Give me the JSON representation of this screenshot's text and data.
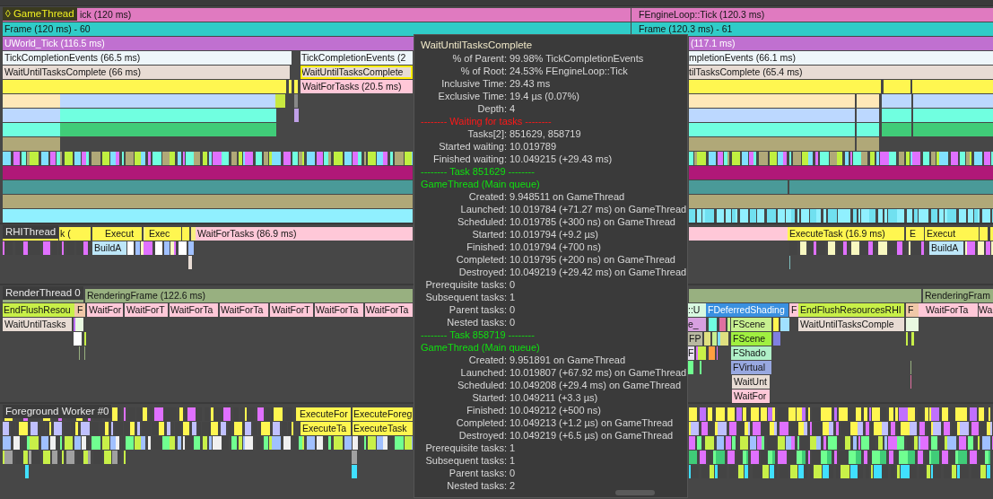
{
  "tracks": [
    {
      "name": "GameThread",
      "marker": "◊",
      "selected": true,
      "rows": [
        {
          "events": [
            {
              "text": "ick (120 ms)",
              "color": "#e07ac0",
              "selected": false
            },
            {
              "text": "FEngineLoop::Tick (120.3 ms)",
              "color": "#e07ac0",
              "selected": false
            }
          ]
        },
        {
          "events": [
            {
              "text": "Frame (120 ms) -  60",
              "color": "#30ccc8",
              "selected": false
            },
            {
              "text": "Frame (120.3 ms) -  61",
              "color": "#30ccc8",
              "selected": false
            }
          ]
        },
        {
          "events": [
            {
              "text": "UWorld_Tick (116.5 ms)",
              "color": "#c070d0",
              "selected": false
            },
            {
              "text": "(117.1 ms)",
              "color": "#c070d0",
              "selected": false
            }
          ]
        },
        {
          "events": [
            {
              "text": "TickCompletionEvents (66.5 ms)",
              "color": "#eef6fa",
              "selected": false
            },
            {
              "text": "TickCompletionEvents (2",
              "color": "#eef6fa",
              "selected": false
            },
            {
              "text": "mpletionEvents (66.1 ms)",
              "color": "#eef6fa",
              "selected": false
            }
          ]
        },
        {
          "events": [
            {
              "text": "WaitUntilTasksComplete (66 ms)",
              "color": "#e8dcd4",
              "selected": false
            },
            {
              "text": "WaitUntilTasksComplete",
              "color": "#e8dcd4",
              "selected": true
            },
            {
              "text": "tilTasksComplete (65.4 ms)",
              "color": "#e8dcd4",
              "selected": false
            }
          ]
        },
        {
          "events": [
            {
              "text": "WaitForTasks (20.5 ms)",
              "color": "#ffc8d8",
              "selected": false
            }
          ]
        }
      ]
    },
    {
      "name": "RHIThread",
      "selected": false,
      "rows": [
        {
          "events": [
            {
              "text": "k (",
              "color": "#fff650",
              "selected": false
            },
            {
              "text": "Execut",
              "color": "#fff650",
              "selected": false
            },
            {
              "text": "Exec",
              "color": "#fff650",
              "selected": false
            },
            {
              "text": "WaitForTasks (86.9 ms)",
              "color": "#ffc8d8",
              "selected": false
            },
            {
              "text": "ExecuteTask (16.9 ms)",
              "color": "#fff650",
              "selected": false
            },
            {
              "text": "E",
              "color": "#fff650",
              "selected": false
            },
            {
              "text": "Execut",
              "color": "#fff650",
              "selected": false
            }
          ]
        },
        {
          "events": [
            {
              "text": "BuildA",
              "color": "#bde6f8",
              "selected": false
            },
            {
              "text": "BuildA",
              "color": "#bde6f8",
              "selected": false
            }
          ]
        }
      ]
    },
    {
      "name": "RenderThread 0",
      "selected": false,
      "rows": [
        {
          "events": [
            {
              "text": "RenderingFrame (122.6 ms)",
              "color": "#98b080",
              "selected": false
            },
            {
              "text": "RenderingFram",
              "color": "#98b080",
              "selected": false
            }
          ]
        },
        {
          "events": [
            {
              "text": "EndFlushResou",
              "color": "#c8f048",
              "selected": false
            },
            {
              "text": "F",
              "color": "#f0c8a8",
              "selected": false
            },
            {
              "text": "WaitFor",
              "color": "#ffc8d8",
              "selected": false
            },
            {
              "text": "WaitForT",
              "color": "#ffc8d8",
              "selected": false
            },
            {
              "text": "WaitForTa",
              "color": "#ffc8d8",
              "selected": false
            },
            {
              "text": "WaitForTa",
              "color": "#ffc8d8",
              "selected": false
            },
            {
              "text": "WaitForT",
              "color": "#ffc8d8",
              "selected": false
            },
            {
              "text": "WaitForTa",
              "color": "#ffc8d8",
              "selected": false
            },
            {
              "text": "WaitForTa",
              "color": "#ffc8d8",
              "selected": false
            },
            {
              "text": "::U",
              "color": "#d8f8e0",
              "selected": false
            },
            {
              "text": "FDeferredShading",
              "color": "#3a90e0",
              "selected": false
            },
            {
              "text": "F",
              "color": "#ffc8d8",
              "selected": false
            },
            {
              "text": "EndFlushResourcesRHI",
              "color": "#c8f048",
              "selected": false
            },
            {
              "text": "F",
              "color": "#f0c8a8",
              "selected": false
            },
            {
              "text": "WaitForTa",
              "color": "#ffc8d8",
              "selected": false
            },
            {
              "text": "Wa",
              "color": "#ffc8d8",
              "selected": false
            }
          ]
        },
        {
          "events": [
            {
              "text": "WaitUntilTasks",
              "color": "#e8dcd4",
              "selected": false
            },
            {
              "text": "e_",
              "color": "#d8a0e0",
              "selected": false
            },
            {
              "text": "FScene",
              "color": "#c8f090",
              "selected": false
            },
            {
              "text": "WaitUntilTasksComple",
              "color": "#e8dcd4",
              "selected": false
            }
          ]
        },
        {
          "events": [
            {
              "text": "FP",
              "color": "#b8b8a0",
              "selected": false
            },
            {
              "text": "FScene",
              "color": "#a0f040",
              "selected": false
            }
          ]
        },
        {
          "events": [
            {
              "text": "F",
              "color": "#e8e0f0",
              "selected": false
            },
            {
              "text": "FShado",
              "color": "#b0f0c8",
              "selected": false
            }
          ]
        },
        {
          "events": [
            {
              "text": "FVirtual",
              "color": "#98a8e0",
              "selected": false
            }
          ]
        },
        {
          "events": [
            {
              "text": "WaitUnt",
              "color": "#e8dcd4",
              "selected": false
            }
          ]
        },
        {
          "events": [
            {
              "text": "WaitFor",
              "color": "#ffc8d8",
              "selected": false
            }
          ]
        }
      ]
    },
    {
      "name": "Foreground Worker #0",
      "selected": false,
      "rows": [
        {
          "events": [
            {
              "text": "ExecuteFor",
              "color": "#fff650",
              "selected": false
            },
            {
              "text": "ExecuteForeg",
              "color": "#fff650",
              "selected": false
            }
          ]
        },
        {
          "events": [
            {
              "text": "ExecuteTa",
              "color": "#fff650",
              "selected": false
            },
            {
              "text": "ExecuteTask",
              "color": "#fff650",
              "selected": false
            }
          ]
        }
      ]
    }
  ],
  "tooltip": {
    "title": "WaitUntilTasksComplete",
    "lines": [
      {
        "kind": "field",
        "label": "% of Parent:",
        "value": "99.98% TickCompletionEvents"
      },
      {
        "kind": "field",
        "label": "% of Root:",
        "value": "24.53% FEngineLoop::Tick"
      },
      {
        "kind": "field",
        "label": "Inclusive Time:",
        "value": "29.43 ms"
      },
      {
        "kind": "field",
        "label": "Exclusive Time:",
        "value": "19.4 µs (0.07%)"
      },
      {
        "kind": "field",
        "label": "Depth:",
        "value": "4"
      },
      {
        "kind": "heading",
        "text": "-------- Waiting for tasks --------",
        "color": "#ff1818"
      },
      {
        "kind": "field",
        "label": "Tasks[2]:",
        "value": "851629, 858719"
      },
      {
        "kind": "field",
        "label": "Started waiting:",
        "value": "10.019789"
      },
      {
        "kind": "field",
        "label": "Finished waiting:",
        "value": "10.049215 (+29.43 ms)"
      },
      {
        "kind": "heading",
        "text": "-------- Task 851629 --------",
        "color": "#10e010"
      },
      {
        "kind": "heading",
        "text": "GameThread (Main queue)",
        "color": "#10e010"
      },
      {
        "kind": "field",
        "label": "Created:",
        "value": "9.948511 on GameThread"
      },
      {
        "kind": "field",
        "label": "Launched:",
        "value": "10.019784 (+71.27 ms) on GameThread"
      },
      {
        "kind": "field",
        "label": "Scheduled:",
        "value": "10.019785 (+300 ns) on GameThread"
      },
      {
        "kind": "field",
        "label": "Started:",
        "value": "10.019794 (+9.2 µs)"
      },
      {
        "kind": "field",
        "label": "Finished:",
        "value": "10.019794 (+700 ns)"
      },
      {
        "kind": "field",
        "label": "Completed:",
        "value": "10.019795 (+200 ns) on GameThread"
      },
      {
        "kind": "field",
        "label": "Destroyed:",
        "value": "10.049219 (+29.42 ms) on GameThread"
      },
      {
        "kind": "field",
        "label": "Prerequisite tasks:",
        "value": "0"
      },
      {
        "kind": "field",
        "label": "Subsequent tasks:",
        "value": "1"
      },
      {
        "kind": "field",
        "label": "Parent tasks:",
        "value": "0"
      },
      {
        "kind": "field",
        "label": "Nested tasks:",
        "value": "0"
      },
      {
        "kind": "heading",
        "text": "-------- Task 858719 --------",
        "color": "#10e010"
      },
      {
        "kind": "heading",
        "text": "GameThread (Main queue)",
        "color": "#10e010"
      },
      {
        "kind": "field",
        "label": "Created:",
        "value": "9.951891 on GameThread"
      },
      {
        "kind": "field",
        "label": "Launched:",
        "value": "10.019807 (+67.92 ms) on GameThread"
      },
      {
        "kind": "field",
        "label": "Scheduled:",
        "value": "10.049208 (+29.4 ms) on GameThread"
      },
      {
        "kind": "field",
        "label": "Started:",
        "value": "10.049211 (+3.3 µs)"
      },
      {
        "kind": "field",
        "label": "Finished:",
        "value": "10.049212 (+500 ns)"
      },
      {
        "kind": "field",
        "label": "Completed:",
        "value": "10.049213 (+1.2 µs) on GameThread"
      },
      {
        "kind": "field",
        "label": "Destroyed:",
        "value": "10.049219 (+6.5 µs) on GameThread"
      },
      {
        "kind": "field",
        "label": "Prerequisite tasks:",
        "value": "1"
      },
      {
        "kind": "field",
        "label": "Subsequent tasks:",
        "value": "1"
      },
      {
        "kind": "field",
        "label": "Parent tasks:",
        "value": "0"
      },
      {
        "kind": "field",
        "label": "Nested tasks:",
        "value": "2"
      }
    ]
  }
}
